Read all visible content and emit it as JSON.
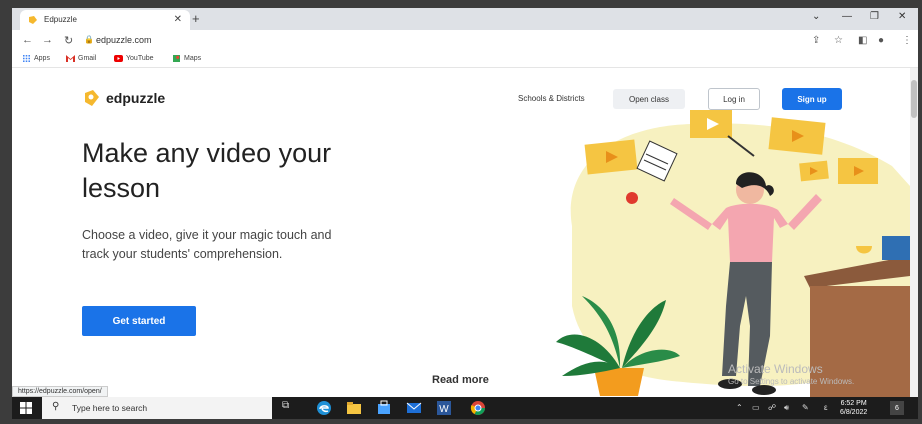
{
  "browser": {
    "tab_title": "Edpuzzle",
    "tab_close": "✕",
    "new_tab": "+",
    "url": "edpuzzle.com",
    "bookmarks": [
      {
        "label": "Apps"
      },
      {
        "label": "Gmail"
      },
      {
        "label": "YouTube"
      },
      {
        "label": "Maps"
      }
    ],
    "status_url": "https://edpuzzle.com/open/"
  },
  "site": {
    "logo_text": "edpuzzle",
    "nav": {
      "schools": "Schools & Districts",
      "open_class": "Open class",
      "login": "Log in",
      "signup": "Sign up"
    },
    "hero": {
      "title": "Make any video your lesson",
      "subtitle": "Choose a video, give it your magic touch and track your students' comprehension.",
      "cta": "Get started"
    },
    "read_more": "Read more"
  },
  "watermark": {
    "line1": "Activate Windows",
    "line2": "Go to Settings to activate Windows."
  },
  "taskbar": {
    "search_placeholder": "Type here to search",
    "time": "6:52 PM",
    "date": "6/8/2022",
    "notification_count": "6"
  },
  "colors": {
    "brand_blue": "#1a73e8",
    "accent_yellow": "#f5c542",
    "blob": "#f7f1c0"
  }
}
